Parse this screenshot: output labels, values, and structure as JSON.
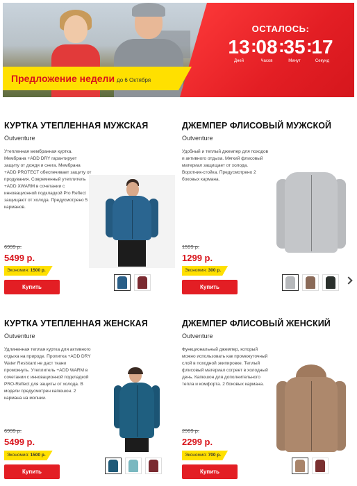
{
  "banner": {
    "promo_title": "Предложение недели",
    "promo_date": "до 6 Октября",
    "countdown_label": "ОСТАЛОСЬ:",
    "countdown": [
      {
        "value": "13",
        "unit": "Дней"
      },
      {
        "value": "08",
        "unit": "Часов"
      },
      {
        "value": "35",
        "unit": "Минут"
      },
      {
        "value": "17",
        "unit": "Секунд"
      }
    ]
  },
  "products": [
    {
      "title": "КУРТКА УТЕПЛЕННАЯ МУЖСКАЯ",
      "brand": "Outventure",
      "description": "Утепленная мембранная куртка. Мембрана +ADD DRY гарантирует защиту от дождя и снега. Мембрана +ADD PROTECT обеспечивает защиту от продувания. Современный утеплитель +ADD ⅩWARM в сочетании с инновационной подкладкой Pro Reflect защищают от холода. Предусмотрено 5 карманов.",
      "old_price": "6999 р.",
      "price": "5499 р.",
      "savings_label": "Экономия:",
      "savings_value": "1500 р.",
      "buy_label": "Купить",
      "colors": [
        "#2a5f88",
        "#7a2a30"
      ]
    },
    {
      "title": "ДЖЕМПЕР ФЛИСОВЫЙ МУЖСКОЙ",
      "brand": "Outventure",
      "description": "Удобный и теплый джемпер для походов и активного отдыха. Мягкий флисовый материал защищает от холода. Воротник-стойка. Предусмотрено 2 боковых кармана.",
      "old_price": "1599 р.",
      "price": "1299 р.",
      "savings_label": "Экономия:",
      "savings_value": "300 р.",
      "buy_label": "Купить",
      "colors": [
        "#b7b9bc",
        "#8a6a58",
        "#2a302c"
      ]
    },
    {
      "title": "КУРТКА УТЕПЛЕННАЯ ЖЕНСКАЯ",
      "brand": "Outventure",
      "description": "Удлиненная теплая куртка для активного отдыха на природе. Пропитка +ADD DRY Water Resistant не даст ткани промокнуть. Утеплитель +ADD WARM в сочетании с инновационной подкладкой PRO-Reflect для защиты от холода. В модели предусмотрен капюшон. 2 кармана на молнии.",
      "old_price": "6999 р.",
      "price": "5499 р.",
      "savings_label": "Экономия:",
      "savings_value": "1500 р.",
      "buy_label": "Купить",
      "colors": [
        "#1f5a78",
        "#7ab8c0",
        "#7a2a30"
      ]
    },
    {
      "title": "ДЖЕМПЕР ФЛИСОВЫЙ ЖЕНСКИЙ",
      "brand": "Outventure",
      "description": "Функциональный джемпер, который можно использовать как промежуточный слой в походной экипировке. Теплый флисовый материал согреет в холодный день. Капюшон для дополнительного тепла и комфорта. 2 боковых кармана.",
      "old_price": "2999 р.",
      "price": "2299 р.",
      "savings_label": "Экономия:",
      "savings_value": "700 р.",
      "buy_label": "Купить",
      "colors": [
        "#a9846a",
        "#7a3030"
      ]
    }
  ]
}
